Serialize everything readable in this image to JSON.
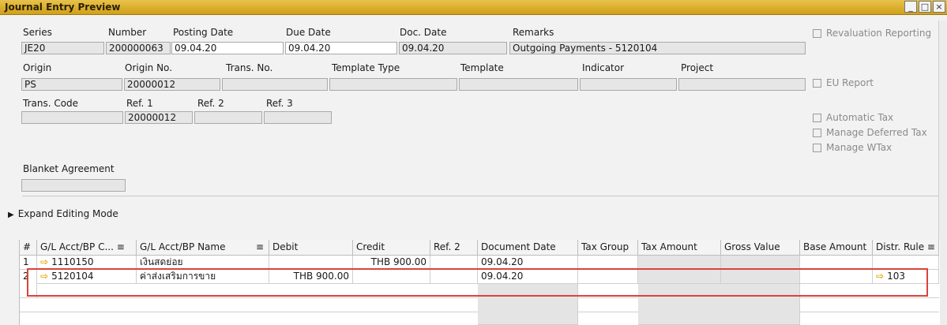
{
  "window": {
    "title": "Journal Entry Preview",
    "min": "_",
    "max": "□",
    "close": "×"
  },
  "header": {
    "series": {
      "label": "Series",
      "value": "JE20"
    },
    "number": {
      "label": "Number",
      "value": "200000063"
    },
    "posting_date": {
      "label": "Posting Date",
      "value": "09.04.20"
    },
    "due_date": {
      "label": "Due Date",
      "value": "09.04.20"
    },
    "doc_date": {
      "label": "Doc. Date",
      "value": "09.04.20"
    },
    "remarks": {
      "label": "Remarks",
      "value": "Outgoing Payments - 5120104"
    },
    "origin": {
      "label": "Origin",
      "value": "PS"
    },
    "origin_no": {
      "label": "Origin No.",
      "value": "20000012"
    },
    "trans_no": {
      "label": "Trans. No.",
      "value": ""
    },
    "template_type": {
      "label": "Template Type",
      "value": ""
    },
    "template": {
      "label": "Template",
      "value": ""
    },
    "indicator": {
      "label": "Indicator",
      "value": ""
    },
    "project": {
      "label": "Project",
      "value": ""
    },
    "trans_code": {
      "label": "Trans. Code",
      "value": ""
    },
    "ref1": {
      "label": "Ref. 1",
      "value": "20000012"
    },
    "ref2": {
      "label": "Ref. 2",
      "value": ""
    },
    "ref3": {
      "label": "Ref. 3",
      "value": ""
    },
    "blanket_agreement": {
      "label": "Blanket Agreement",
      "value": ""
    }
  },
  "checkboxes": {
    "revaluation": "Revaluation Reporting",
    "eu_report": "EU Report",
    "automatic_tax": "Automatic Tax",
    "manage_deferred_tax": "Manage Deferred Tax",
    "manage_wtax": "Manage WTax"
  },
  "expand_editing": "Expand Editing Mode",
  "grid": {
    "columns": {
      "num": "#",
      "acct": "G/L Acct/BP C... ≡",
      "name": "G/L Acct/BP Name",
      "name_icon": "≡",
      "debit": "Debit",
      "credit": "Credit",
      "ref2": "Ref. 2",
      "doc_date": "Document Date",
      "tax_group": "Tax Group",
      "tax_amount": "Tax Amount",
      "gross_value": "Gross Value",
      "base_amount": "Base Amount",
      "distr_rule": "Distr. Rule ≡"
    },
    "rows": [
      {
        "num": "1",
        "acct": "1110150",
        "name": "เงินสดย่อย",
        "debit": "",
        "credit": "THB 900.00",
        "ref2": "",
        "doc_date": "09.04.20",
        "distr_rule": ""
      },
      {
        "num": "2",
        "acct": "5120104",
        "name": "ค่าส่งเสริมการขาย",
        "debit": "THB 900.00",
        "credit": "",
        "ref2": "",
        "doc_date": "09.04.20",
        "distr_rule": "103"
      }
    ],
    "arrow_glyph": "⇨"
  },
  "colors": {
    "highlight_border": "#d9443a",
    "link_arrow": "#e8a400",
    "titlebar": "#d0a018"
  }
}
